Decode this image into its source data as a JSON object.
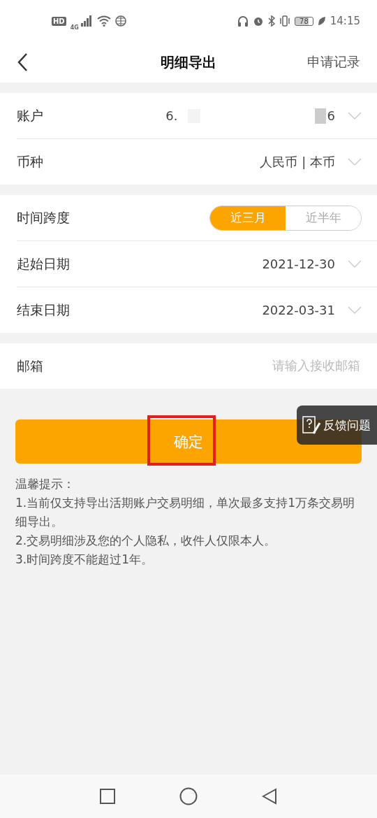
{
  "status_bar": {
    "hd": "HD",
    "network": "4G",
    "battery": "78",
    "time": "14:15"
  },
  "header": {
    "title": "明细导出",
    "action": "申请记录"
  },
  "account_section": [
    {
      "kind": "masked",
      "label": "账户",
      "value_start": "6.",
      "value_end": "6"
    },
    {
      "kind": "select",
      "label": "币种",
      "value": "人民币 | 本币"
    }
  ],
  "time_section": [
    {
      "kind": "segmented",
      "label": "时间跨度",
      "options": [
        {
          "label": "近三月",
          "selected": true
        },
        {
          "label": "近半年",
          "selected": false
        }
      ]
    },
    {
      "kind": "select",
      "label": "起始日期",
      "value": "2021-12-30"
    },
    {
      "kind": "select",
      "label": "结束日期",
      "value": "2022-03-31"
    }
  ],
  "email": {
    "label": "邮箱",
    "placeholder": "请输入接收邮箱"
  },
  "confirm_button": {
    "label": "确定",
    "highlighted": true
  },
  "feedback": {
    "label": "反馈问题"
  },
  "notes": [
    "温馨提示：",
    "1.当前仅支持导出活期账户交易明细，单次最多支持1万条交易明细导出。",
    "2.交易明细涉及您的个人隐私，收件人仅限本人。",
    "3.时间跨度不能超过1年。"
  ]
}
